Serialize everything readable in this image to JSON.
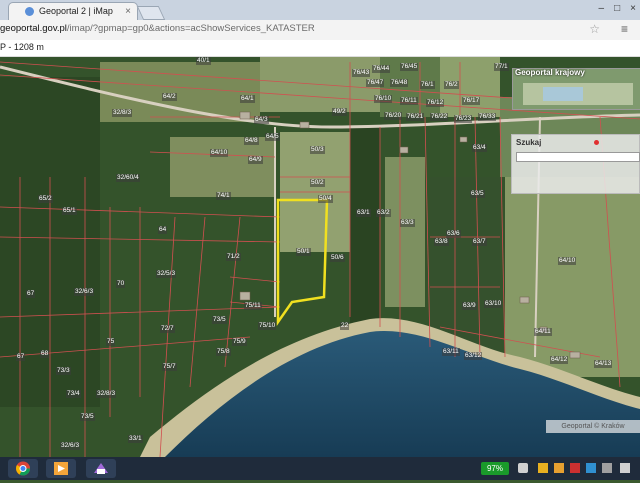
{
  "browser": {
    "tab_title": "Geoportal 2 | iMap",
    "tab_close": "×",
    "url_domain": "geoportal.gov.pl",
    "url_path": "/imap/?gpmap=gp0&actions=acShowServices_KATASTER",
    "window_min": "–",
    "window_max": "□",
    "window_close": "×",
    "star": "☆",
    "menu": "≡"
  },
  "map": {
    "scale_text": "P - 1208 m",
    "overview_title": "Geoportal krajowy",
    "search_title": "Szukaj",
    "search_value": "",
    "copyright": "Geoportal © Kraków",
    "highlight_color": "#f0e020",
    "parcel_line_color": "#d05050",
    "parcel_labels": [
      "40/1",
      "64/1",
      "64/2",
      "64/3",
      "32/8/3",
      "64/5",
      "64/8",
      "64/9",
      "64/10",
      "49/2",
      "50/3",
      "50/4",
      "50/2",
      "50/1",
      "50/6",
      "76/43",
      "76/44",
      "76/45",
      "77/1",
      "76/47",
      "76/48",
      "76/1",
      "76/2",
      "76/10",
      "76/11",
      "76/12",
      "76/17",
      "76/20",
      "76/21",
      "76/22",
      "76/23",
      "76/33",
      "32/60/4",
      "65/1",
      "65/2",
      "64",
      "71/2",
      "70",
      "67",
      "32/6/3",
      "32/5/3",
      "73/5",
      "75/11",
      "75/10",
      "72/7",
      "75/7",
      "75/9",
      "75/8",
      "22",
      "74/1",
      "63/1",
      "63/2",
      "63/3",
      "63/4",
      "63/5",
      "63/6",
      "63/7",
      "63/8",
      "63/9",
      "63/10",
      "63/11",
      "63/12",
      "64/10",
      "64/11",
      "64/12",
      "64/13",
      "67",
      "68",
      "73/3",
      "73/4",
      "73/5",
      "75",
      "32/8/3",
      "32/6/3",
      "33/1"
    ]
  },
  "taskbar": {
    "battery": "97%",
    "apps": [
      "chrome-icon",
      "media-player-icon",
      "shield-app-icon"
    ]
  }
}
